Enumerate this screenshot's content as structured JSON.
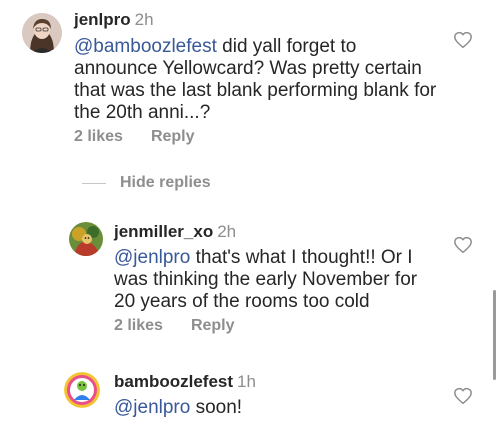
{
  "comments": [
    {
      "username": "jenlpro",
      "time": "2h",
      "mention": "@bamboozlefest",
      "lines": [
        " did yall forget to",
        "announce Yellowcard? Was pretty certain",
        "that was the last blank performing blank for",
        "the 20th anni...?"
      ],
      "likes": "2 likes",
      "reply": "Reply",
      "avatar_icon": "profile-photo-woman"
    },
    {
      "username": "jenmiller_xo",
      "time": "2h",
      "mention": "@jenlpro",
      "lines": [
        " that's what I thought!! Or I",
        "was thinking the early November for",
        "20 years of the rooms too cold"
      ],
      "likes": "2 likes",
      "reply": "Reply",
      "avatar_icon": "profile-photo-cartoon"
    },
    {
      "username": "bamboozlefest",
      "time": "1h",
      "mention": "@jenlpro",
      "lines": [
        " soon!"
      ],
      "avatar_icon": "profile-photo-logo"
    }
  ],
  "hide_replies": "Hide replies",
  "icons": {
    "like": "heart-outline-icon"
  },
  "colors": {
    "mention": "#385898",
    "muted": "#8e8e8e",
    "text": "#262626"
  }
}
